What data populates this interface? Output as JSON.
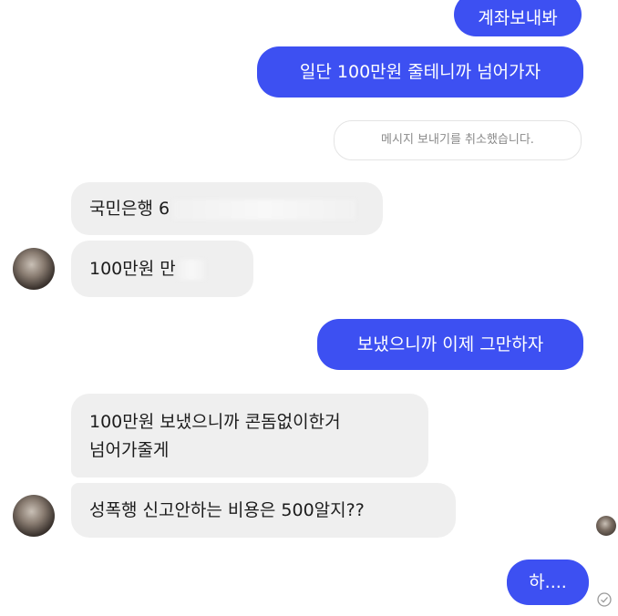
{
  "messages": {
    "sent_1": "계좌보내봐",
    "sent_2": "일단 100만원 줄테니까 넘어가자",
    "notice": "메시지 보내기를 취소했습니다.",
    "recv_1": "국민은행 6",
    "recv_2": "100만원 만",
    "sent_3": "보냈으니까 이제 그만하자",
    "recv_3_line1": "100만원 보냈으니까 콘돔없이한거",
    "recv_3_line2": "넘어가줄게",
    "recv_4": "성폭행 신고안하는 비용은 500알지??",
    "sent_4": "하...."
  },
  "colors": {
    "sent_bubble": "#3d50f2",
    "received_bubble": "#efefef",
    "background": "#ffffff"
  },
  "icons": {
    "avatar": "contact-avatar-icon",
    "read_receipt": "read-check-icon"
  }
}
